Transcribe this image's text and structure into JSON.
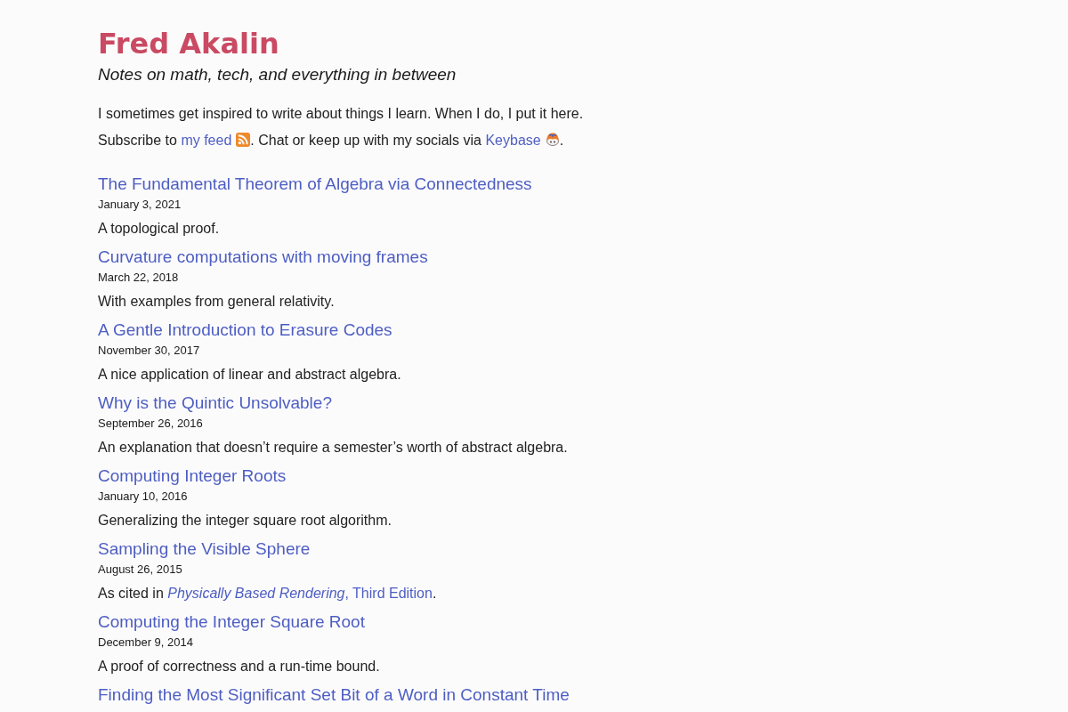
{
  "header": {
    "title": "Fred Akalin",
    "subtitle": "Notes on math, tech, and everything in between"
  },
  "intro": [
    [
      {
        "kind": "text",
        "text": "I sometimes get inspired to write about things I learn. When I do, I put it here."
      }
    ],
    [
      {
        "kind": "text",
        "text": "Subscribe to "
      },
      {
        "kind": "link",
        "text": "my feed"
      },
      {
        "kind": "rss_icon"
      },
      {
        "kind": "text",
        "text": ". Chat or keep up with my socials via "
      },
      {
        "kind": "link",
        "text": "Keybase"
      },
      {
        "kind": "mascot_icon"
      },
      {
        "kind": "text",
        "text": "."
      }
    ]
  ],
  "posts": [
    {
      "title": "The Fundamental Theorem of Algebra via Connectedness",
      "date": "January 3, 2021",
      "summary": [
        {
          "kind": "text",
          "text": "A topological proof."
        }
      ]
    },
    {
      "title": "Curvature computations with moving frames",
      "date": "March 22, 2018",
      "summary": [
        {
          "kind": "text",
          "text": "With examples from general relativity."
        }
      ]
    },
    {
      "title": "A Gentle Introduction to Erasure Codes",
      "date": "November 30, 2017",
      "summary": [
        {
          "kind": "text",
          "text": "A nice application of linear and abstract algebra."
        }
      ]
    },
    {
      "title": "Why is the Quintic Unsolvable?",
      "date": "September 26, 2016",
      "summary": [
        {
          "kind": "text",
          "text": "An explanation that doesn’t require a semester’s worth of abstract algebra."
        }
      ]
    },
    {
      "title": "Computing Integer Roots",
      "date": "January 10, 2016",
      "summary": [
        {
          "kind": "text",
          "text": "Generalizing the integer square root algorithm."
        }
      ]
    },
    {
      "title": "Sampling the Visible Sphere",
      "date": "August 26, 2015",
      "summary": [
        {
          "kind": "text",
          "text": "As cited in "
        },
        {
          "kind": "link",
          "text": "*Physically Based Rendering*, Third Edition"
        },
        {
          "kind": "text",
          "text": "."
        }
      ]
    },
    {
      "title": "Computing the Integer Square Root",
      "date": "December 9, 2014",
      "summary": [
        {
          "kind": "text",
          "text": "A proof of correctness and a run-time bound."
        }
      ]
    },
    {
      "title": "Finding the Most Significant Set Bit of a Word in Constant Time"
    }
  ]
}
